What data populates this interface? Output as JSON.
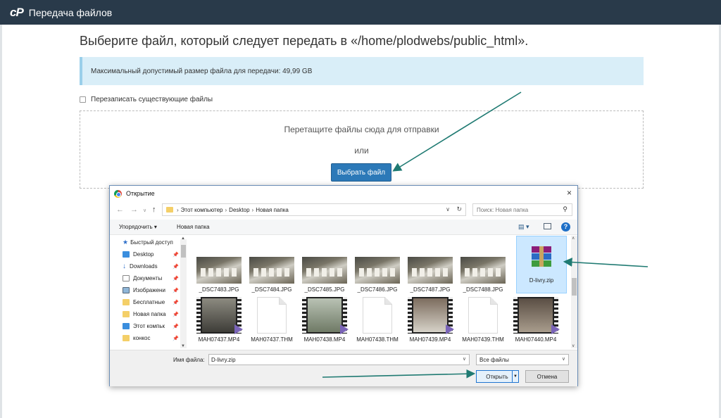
{
  "app": {
    "logo": "cP",
    "title": "Передача файлов"
  },
  "upload": {
    "heading": "Выберите файл, который следует передать в «/home/plodwebs/public_html».",
    "max_size_notice": "Максимальный допустимый размер файла для передачи: 49,99 GB",
    "overwrite_label": "Перезаписать существующие файлы",
    "drop_text": "Перетащите файлы сюда для отправки",
    "or_text": "или",
    "choose_button": "Выбрать файл"
  },
  "dialog": {
    "title": "Открытие",
    "close": "×",
    "breadcrumb": [
      "Этот компьютер",
      "Desktop",
      "Новая папка"
    ],
    "search_placeholder": "Поиск: Новая папка",
    "toolbar": {
      "organize": "Упорядочить ▾",
      "new_folder": "Новая папка"
    },
    "sidebar": [
      {
        "label": "Быстрый доступ",
        "icon": "star-icon",
        "pinned": false
      },
      {
        "label": "Desktop",
        "icon": "desktop-icon",
        "pinned": true
      },
      {
        "label": "Downloads",
        "icon": "download-icon",
        "pinned": true
      },
      {
        "label": "Документы",
        "icon": "documents-icon",
        "pinned": true
      },
      {
        "label": "Изображени",
        "icon": "pictures-icon",
        "pinned": true
      },
      {
        "label": "Бесплатные",
        "icon": "folder-icon",
        "pinned": true
      },
      {
        "label": "Новая папка",
        "icon": "folder-icon",
        "pinned": true
      },
      {
        "label": "Этот компьк",
        "icon": "computer-icon",
        "pinned": true
      },
      {
        "label": "конкос",
        "icon": "folder-icon",
        "pinned": true
      }
    ],
    "files_row1": [
      "_DSC7483.JPG",
      "_DSC7484.JPG",
      "_DSC7485.JPG",
      "_DSC7486.JPG",
      "_DSC7487.JPG",
      "_DSC7488.JPG"
    ],
    "files_row2": [
      {
        "name": "MAH07437.MP4",
        "kind": "video"
      },
      {
        "name": "MAH07437.THM",
        "kind": "doc"
      },
      {
        "name": "MAH07438.MP4",
        "kind": "video"
      },
      {
        "name": "MAH07438.THM",
        "kind": "doc"
      },
      {
        "name": "MAH07439.MP4",
        "kind": "video"
      },
      {
        "name": "MAH07439.THM",
        "kind": "doc"
      },
      {
        "name": "MAH07440.MP4",
        "kind": "video"
      }
    ],
    "selected_file": "D-livry.zip",
    "file_name_label": "Имя файла:",
    "file_name_value": "D-livry.zip",
    "file_type": "Все файлы",
    "open_button": "Открыть",
    "cancel_button": "Отмена"
  },
  "colors": {
    "topbar": "#293a4a",
    "info_bg": "#d9eef8",
    "primary_button": "#2c79b8",
    "arrow": "#1f7a72",
    "selection": "#cce8ff"
  }
}
